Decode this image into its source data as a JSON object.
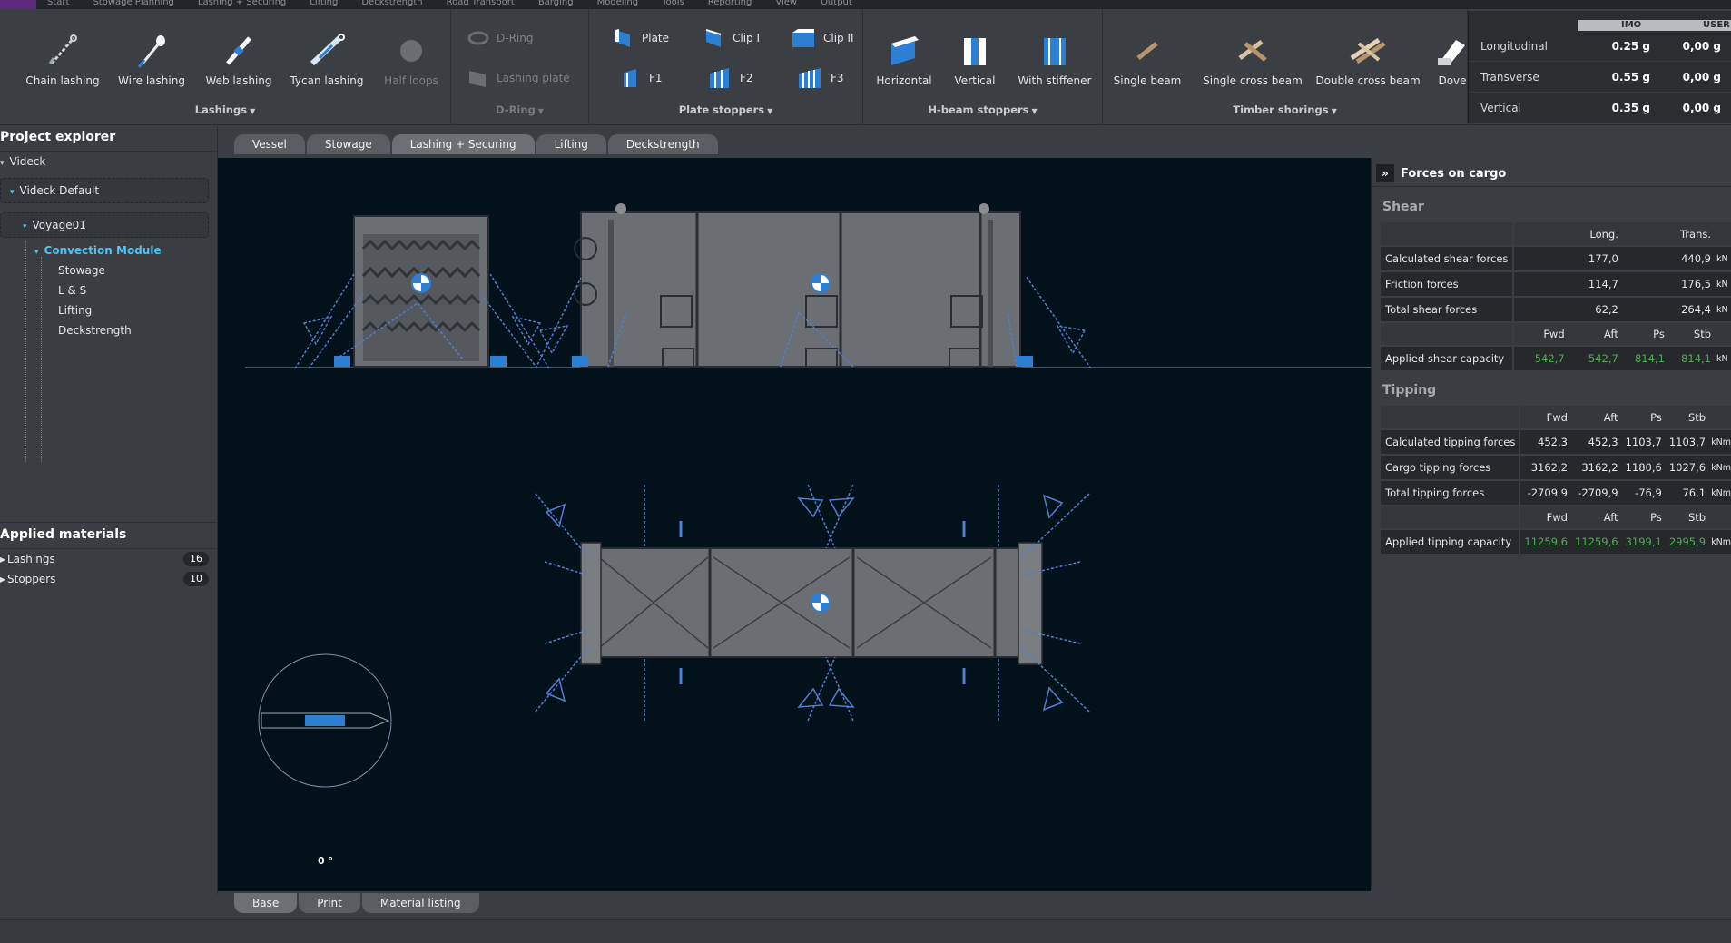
{
  "menu": {
    "items": [
      "Start",
      "Stowage Planning",
      "Lashing + Securing",
      "Lifting",
      "Deckstrength",
      "Road Transport",
      "Barging",
      "Modeling",
      "Tools",
      "Reporting",
      "View",
      "Output"
    ]
  },
  "ribbon": {
    "lashings": {
      "title": "Lashings",
      "buttons": [
        "Chain lashing",
        "Wire lashing",
        "Web lashing",
        "Tycan lashing",
        "Half loops"
      ]
    },
    "dring": {
      "title": "D-Ring",
      "buttons": [
        "D-Ring",
        "Lashing plate"
      ]
    },
    "plate_stoppers": {
      "title": "Plate stoppers",
      "buttons": [
        "Plate",
        "Clip I",
        "Clip II",
        "F1",
        "F2",
        "F3"
      ]
    },
    "hbeam_stoppers": {
      "title": "H-beam stoppers",
      "buttons": [
        "Horizontal",
        "Vertical",
        "With stiffener"
      ]
    },
    "timber_shorings": {
      "title": "Timber shorings",
      "buttons": [
        "Single beam",
        "Single cross beam",
        "Double cross beam",
        "Dove"
      ]
    }
  },
  "accelerations": {
    "imo_label": "IMO",
    "user_label": "USER",
    "rows": [
      {
        "name": "Longitudinal",
        "imo": "0.25 g",
        "user": "0,00   g"
      },
      {
        "name": "Transverse",
        "imo": "0.55 g",
        "user": "0,00   g"
      },
      {
        "name": "Vertical",
        "imo": "0.35 g",
        "user": "0,00   g"
      }
    ]
  },
  "explorer": {
    "title": "Project explorer",
    "root": "Videck",
    "level1": "Videck Default",
    "level2": "Voyage01",
    "level3": "Convection Module",
    "children": [
      "Stowage",
      "L & S",
      "Lifting",
      "Deckstrength"
    ]
  },
  "materials": {
    "title": "Applied materials",
    "items": [
      {
        "label": "Lashings",
        "count": "16"
      },
      {
        "label": "Stoppers",
        "count": "10"
      }
    ]
  },
  "top_tabs": [
    "Vessel",
    "Stowage",
    "Lashing + Securing",
    "Lifting",
    "Deckstrength"
  ],
  "bottom_tabs": [
    "Base",
    "Print",
    "Material listing"
  ],
  "compass": {
    "heading": "0 °"
  },
  "forces": {
    "title": "Forces on cargo",
    "shear": {
      "title": "Shear",
      "col_long": "Long.",
      "col_trans": "Trans.",
      "rows": [
        {
          "name": "Calculated shear forces",
          "long": "177,0",
          "trans": "440,9",
          "unit": "kN"
        },
        {
          "name": "Friction forces",
          "long": "114,7",
          "trans": "176,5",
          "unit": "kN"
        },
        {
          "name": "Total shear forces",
          "long": "62,2",
          "trans": "264,4",
          "unit": "kN"
        }
      ],
      "cap_headers": [
        "Fwd",
        "Aft",
        "Ps",
        "Stb"
      ],
      "capacity": {
        "name": "Applied shear capacity",
        "values": [
          "542,7",
          "542,7",
          "814,1",
          "814,1"
        ],
        "unit": "kN"
      }
    },
    "tipping": {
      "title": "Tipping",
      "headers": [
        "Fwd",
        "Aft",
        "Ps",
        "Stb"
      ],
      "rows": [
        {
          "name": "Calculated tipping forces",
          "values": [
            "452,3",
            "452,3",
            "1103,7",
            "1103,7"
          ],
          "unit": "kNm"
        },
        {
          "name": "Cargo tipping forces",
          "values": [
            "3162,2",
            "3162,2",
            "1180,6",
            "1027,6"
          ],
          "unit": "kNm"
        },
        {
          "name": "Total tipping forces",
          "values": [
            "-2709,9",
            "-2709,9",
            "-76,9",
            "76,1"
          ],
          "unit": "kNm"
        }
      ],
      "cap_headers": [
        "Fwd",
        "Aft",
        "Ps",
        "Stb"
      ],
      "capacity": {
        "name": "Applied tipping capacity",
        "values": [
          "11259,6",
          "11259,6",
          "3199,1",
          "2995,9"
        ],
        "unit": "kNm"
      }
    }
  },
  "colors": {
    "accent": "#4fc3f7",
    "capacity_green": "#4caf50",
    "viewport_bg": "#03111b",
    "cargo_grey": "#6b6e72",
    "lashing_blue": "#4f7fd0"
  }
}
